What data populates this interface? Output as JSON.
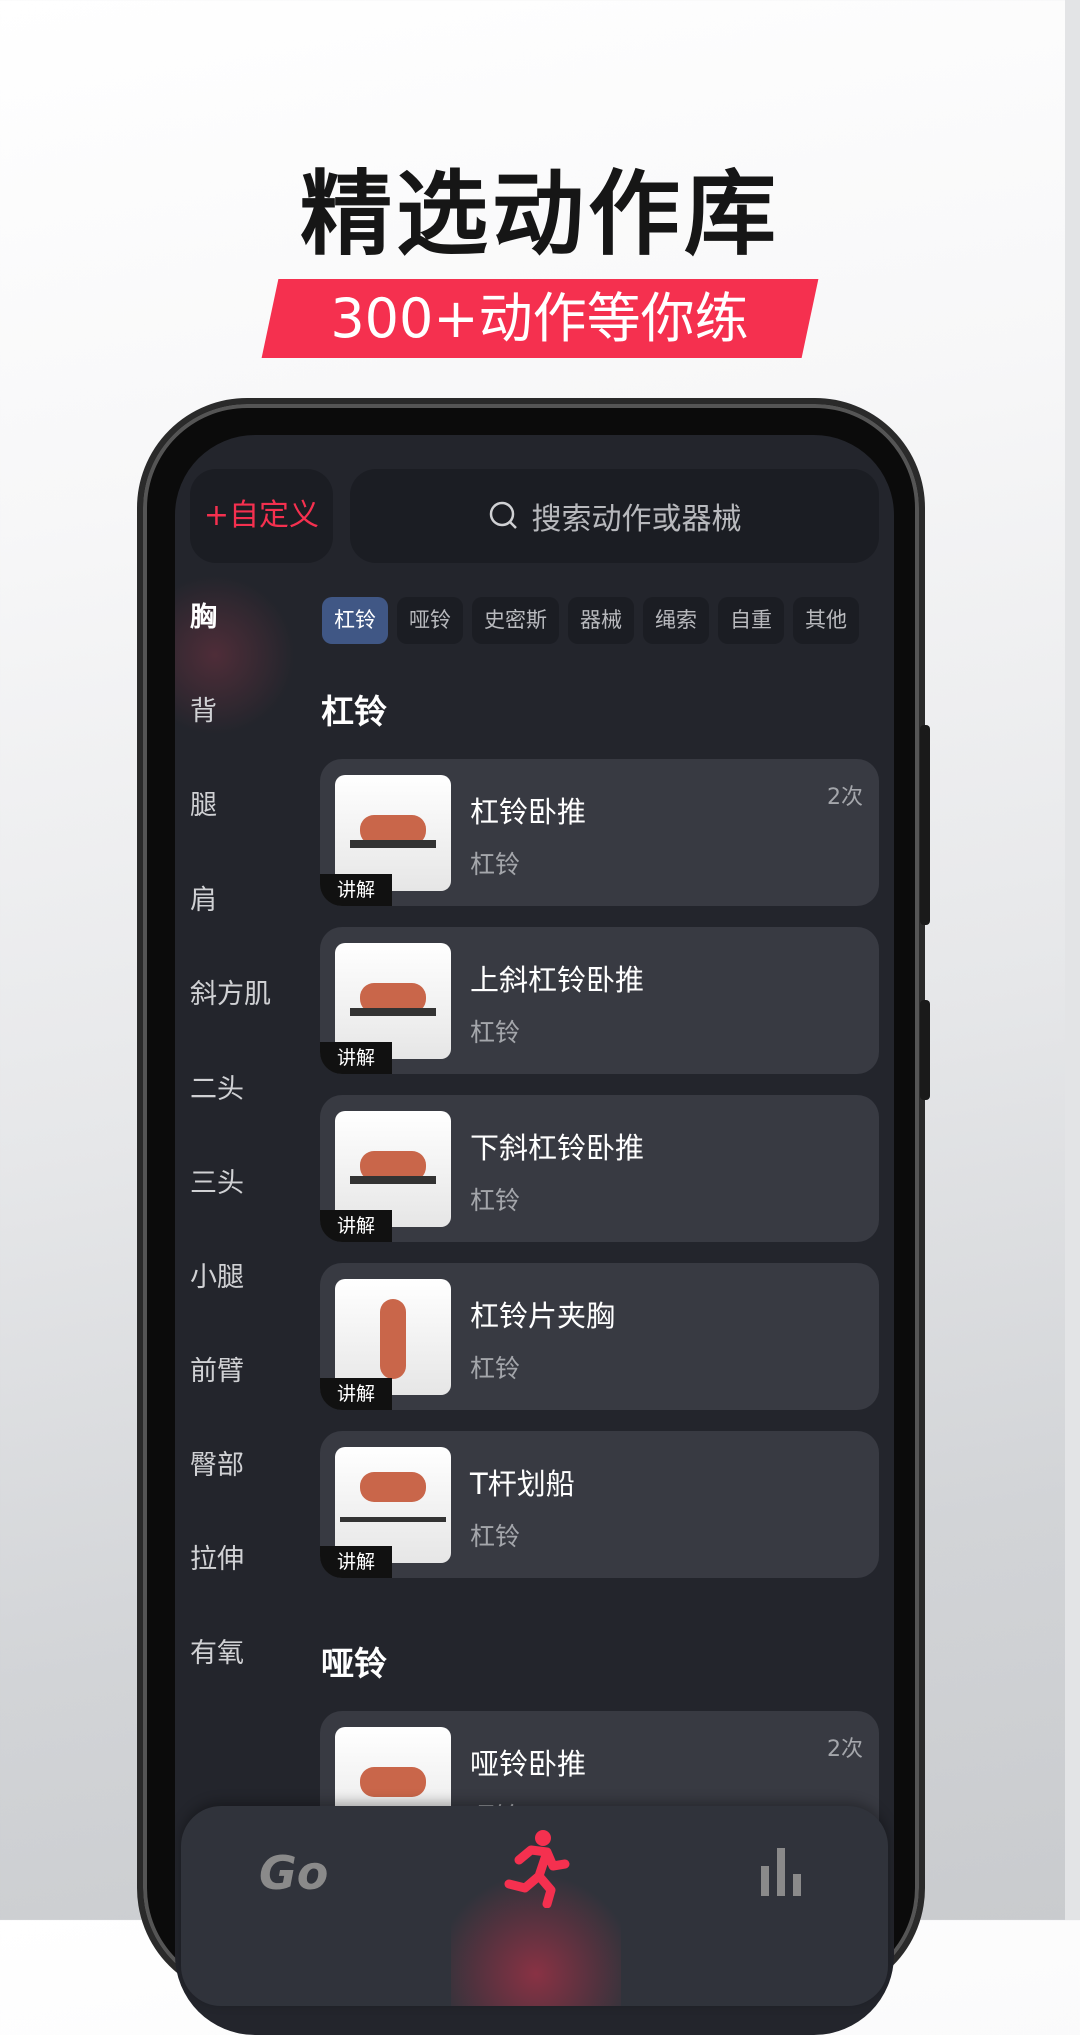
{
  "promo": {
    "headline": "精选动作库",
    "banner": "300+动作等你练",
    "accent": "#f5304f"
  },
  "app": {
    "custom_button": "+自定义",
    "search_placeholder": "搜索动作或器械",
    "sidebar": [
      "胸",
      "背",
      "腿",
      "肩",
      "斜方肌",
      "二头",
      "三头",
      "小腿",
      "前臂",
      "臀部",
      "拉伸",
      "有氧"
    ],
    "sidebar_active": "胸",
    "chips": [
      "杠铃",
      "哑铃",
      "史密斯",
      "器械",
      "绳索",
      "自重",
      "其他"
    ],
    "chip_active": "杠铃",
    "sections": [
      {
        "title": "杠铃",
        "items": [
          {
            "name": "杠铃卧推",
            "equipment": "杠铃",
            "count": "2次",
            "tag": "讲解"
          },
          {
            "name": "上斜杠铃卧推",
            "equipment": "杠铃",
            "tag": "讲解"
          },
          {
            "name": "下斜杠铃卧推",
            "equipment": "杠铃",
            "tag": "讲解"
          },
          {
            "name": "杠铃片夹胸",
            "equipment": "杠铃",
            "tag": "讲解"
          },
          {
            "name": "T杆划船",
            "equipment": "杠铃",
            "tag": "讲解"
          }
        ]
      },
      {
        "title": "哑铃",
        "items": [
          {
            "name": "哑铃卧推",
            "equipment": "哑铃",
            "count": "2次"
          }
        ]
      }
    ],
    "nav": {
      "go_label": "Go",
      "items": [
        "go-icon",
        "running-icon",
        "stats-icon"
      ],
      "active": "running-icon"
    }
  }
}
